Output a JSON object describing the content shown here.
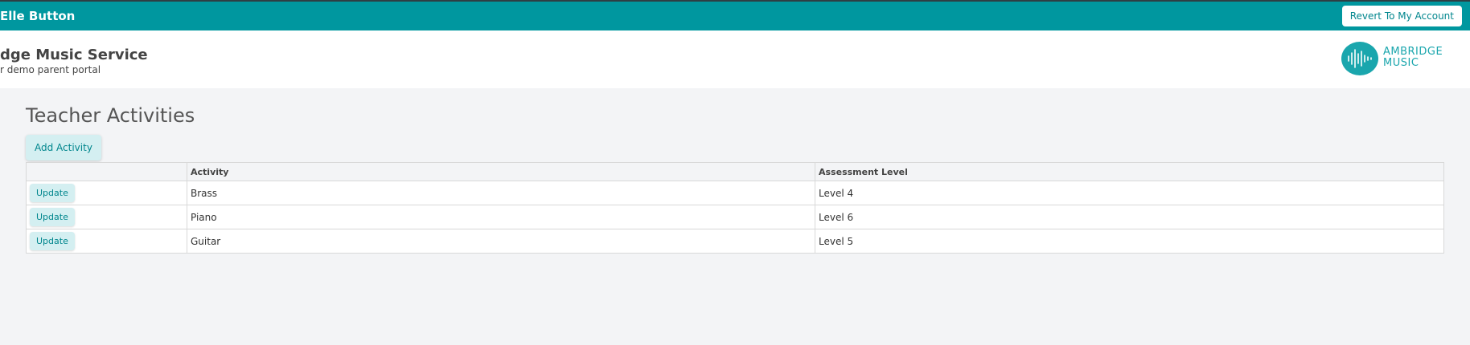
{
  "topbar": {
    "user_name": "Elle Button",
    "revert_label": "Revert To My Account"
  },
  "header": {
    "title": "dge Music Service",
    "subtitle": "r demo parent portal",
    "logo_line1": "AMBRIDGE",
    "logo_line2": "MUSIC"
  },
  "page": {
    "title": "Teacher Activities",
    "add_label": "Add Activity"
  },
  "table": {
    "columns": [
      "",
      "Activity",
      "Assessment Level"
    ],
    "rows": [
      {
        "action": "Update",
        "activity": "Brass",
        "level": "Level 4"
      },
      {
        "action": "Update",
        "activity": "Piano",
        "level": "Level 6"
      },
      {
        "action": "Update",
        "activity": "Guitar",
        "level": "Level 5"
      }
    ]
  },
  "colors": {
    "brand": "#00979f",
    "button_bg": "#d4eff1",
    "button_text": "#00868d"
  },
  "icons": {
    "logo": "soundwave-icon"
  }
}
